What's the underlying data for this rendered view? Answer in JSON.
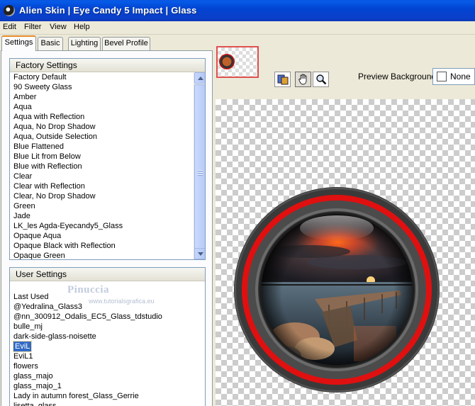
{
  "window": {
    "title": "Alien Skin | Eye Candy 5 Impact | Glass"
  },
  "menu": [
    "Edit",
    "Filter",
    "View",
    "Help"
  ],
  "tabs": [
    {
      "label": "Settings",
      "active": true
    },
    {
      "label": "Basic",
      "active": false
    },
    {
      "label": "Lighting",
      "active": false
    },
    {
      "label": "Bevel Profile",
      "active": false
    }
  ],
  "factory_settings": {
    "header": "Factory Settings",
    "items": [
      "Factory Default",
      "90 Sweety Glass",
      "Amber",
      "Aqua",
      "Aqua with Reflection",
      "Aqua, No Drop Shadow",
      "Aqua, Outside Selection",
      "Blue Flattened",
      "Blue Lit from Below",
      "Blue with Reflection",
      "Clear",
      "Clear with Reflection",
      "Clear, No Drop Shadow",
      "Green",
      "Jade",
      "LK_les Agda-Eyecandy5_Glass",
      "Opaque Aqua",
      "Opaque Black with Reflection",
      "Opaque Green"
    ]
  },
  "user_settings": {
    "header": "User Settings",
    "items": [
      "Last Used",
      "@Yedralina_Glass3",
      "@nn_300912_Odalis_EC5_Glass_tdstudio",
      "bulle_mj",
      "dark-side-glass-noisette",
      "EviL",
      "EviL1",
      "flowers",
      "glass_majo",
      "glass_majo_1",
      "Lady in autumn forest_Glass_Gerrie",
      "lisetta_glass"
    ],
    "selected_index": 5
  },
  "preview_background": {
    "label": "Preview Background:",
    "value": "None"
  },
  "tools": [
    "preview-compare-icon",
    "hand-icon",
    "zoom-icon"
  ],
  "watermark": {
    "name": "Pinuccia",
    "url": "www.tutorialsgrafica.eu"
  },
  "colors": {
    "titlebar": "#0244d2",
    "selection": "#316ac5",
    "glass_ring": "#e01010",
    "window_bg": "#ece9d8"
  }
}
